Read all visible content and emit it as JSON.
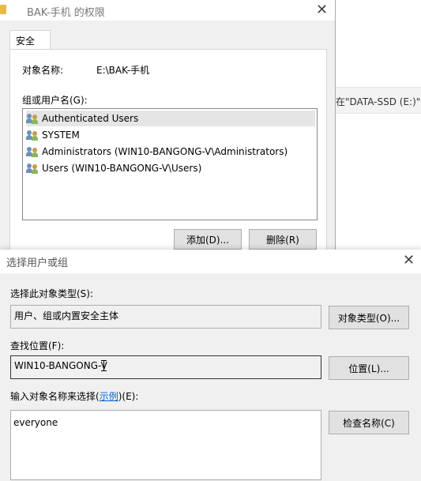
{
  "background_window": {
    "path_fragment": "在\"DATA-SSD (E:)\""
  },
  "permissions_dialog": {
    "title": "BAK-手机 的权限",
    "tab_label": "安全",
    "object_name_label": "对象名称:",
    "object_name_value": "E:\\BAK-手机",
    "group_label": "组或用户名(G):",
    "users": [
      "Authenticated Users",
      "SYSTEM",
      "Administrators (WIN10-BANGONG-V\\Administrators)",
      "Users (WIN10-BANGONG-V\\Users)"
    ],
    "add_button": "添加(D)...",
    "remove_button": "删除(R)"
  },
  "select_users_dialog": {
    "title": "选择用户或组",
    "object_type_label": "选择此对象类型(S):",
    "object_type_value": "用户、组或内置安全主体",
    "object_type_button": "对象类型(O)...",
    "location_label": "查找位置(F):",
    "location_value": "WIN10-BANGONG-V",
    "location_button": "位置(L)...",
    "names_label_prefix": "输入对象名称来选择(",
    "names_label_link": "示例",
    "names_label_suffix": ")(E):",
    "names_value": "everyone",
    "check_names_button": "检查名称(C)"
  },
  "colors": {
    "link": "#0066cc",
    "selection": "#e5e5e5",
    "button_face": "#e1e1e1"
  }
}
